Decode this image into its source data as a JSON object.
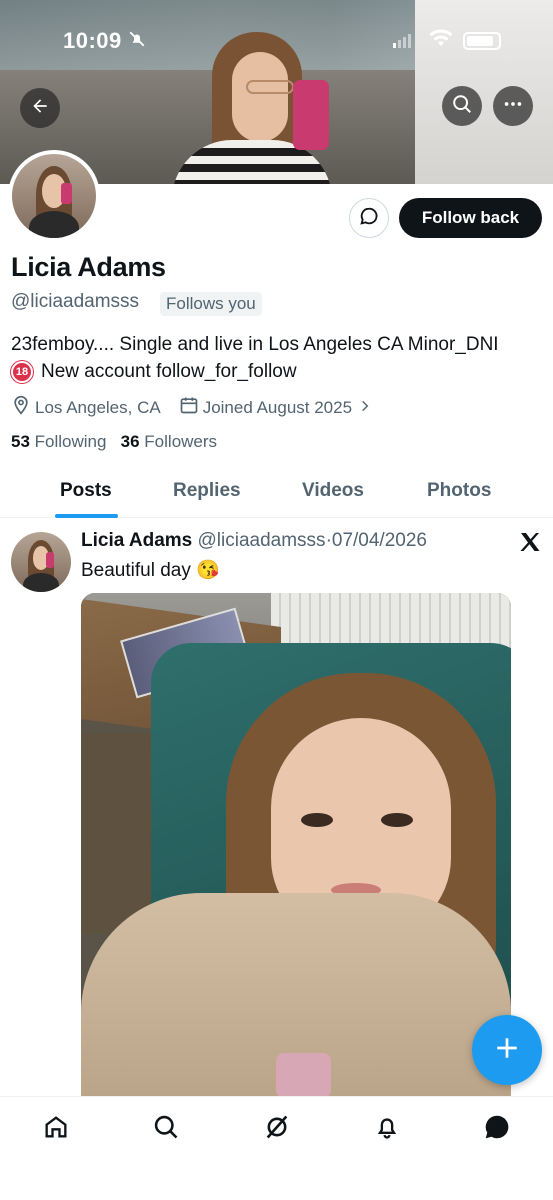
{
  "status_bar": {
    "time": "10:09"
  },
  "profile": {
    "name": "Licia Adams",
    "handle": "@liciaadamsss",
    "follows_you": "Follows you",
    "follow_button": "Follow back",
    "bio_line1": "23femboy.... Single and live in Los Angeles CA Minor_DNI",
    "bio_badge": "18",
    "bio_line2": "New account follow_for_follow",
    "location": "Los Angeles, CA",
    "joined": "Joined August 2025",
    "following_count": "53",
    "following_label": "Following",
    "followers_count": "36",
    "followers_label": "Followers"
  },
  "tabs": [
    {
      "label": "Posts",
      "active": true
    },
    {
      "label": "Replies",
      "active": false
    },
    {
      "label": "Videos",
      "active": false
    },
    {
      "label": "Photos",
      "active": false
    }
  ],
  "post": {
    "author_name": "Licia Adams",
    "author_handle": "@liciaadamsss",
    "separator": "·",
    "date": "07/04/2026",
    "text": "Beautiful day 😘"
  },
  "colors": {
    "accent": "#1d9bf0",
    "text_primary": "#0f1419",
    "text_secondary": "#536471",
    "follow_button_bg": "#0f1419"
  },
  "icons": {
    "back": "arrow-left-icon",
    "search": "search-icon",
    "more": "more-icon",
    "message": "message-icon",
    "location": "location-pin-icon",
    "calendar": "calendar-icon",
    "x_logo": "x-logo-icon",
    "compose": "plus-icon",
    "nav": [
      "home-icon",
      "search-icon",
      "grok-icon",
      "notifications-icon",
      "messages-icon"
    ]
  }
}
